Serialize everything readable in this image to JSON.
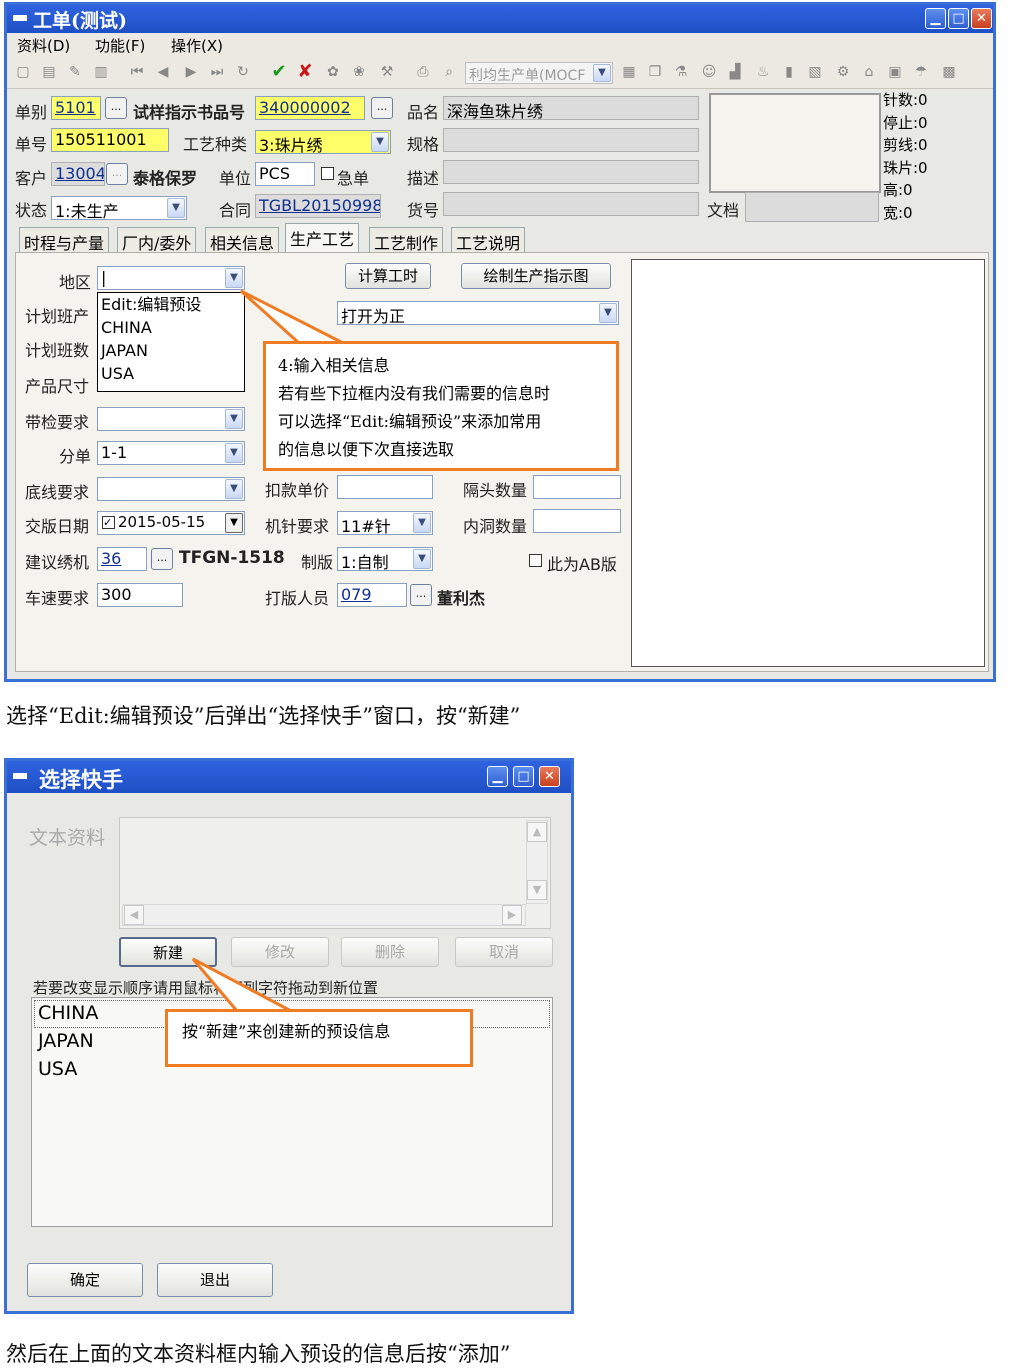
{
  "win1": {
    "title": "工单(测试)",
    "menu": [
      "资料(D)",
      "功能(F)",
      "操作(X)"
    ],
    "toolbar_combo": "利均生产单(MOCF",
    "header": {
      "danbie_label": "单别",
      "danbie_value": "5101",
      "zhishishu_label": "试样指示书品号",
      "zhishishu_value": "340000002",
      "pinming_label": "品名",
      "pinming_value": "深海鱼珠片绣",
      "danhao_label": "单号",
      "danhao_value": "150511001",
      "gongyi_label": "工艺种类",
      "gongyi_value": "3:珠片绣",
      "guige_label": "规格",
      "kehu_label": "客户",
      "kehu_value": "13004",
      "kehu_name": "泰格保罗",
      "danwei_label": "单位",
      "danwei_value": "PCS",
      "jidan_label": "急单",
      "miaoshu_label": "描述",
      "zhuangtai_label": "状态",
      "zhuangtai_value": "1:未生产",
      "hetong_label": "合同",
      "hetong_value": "TGBL20150998",
      "huohao_label": "货号",
      "wendang_label": "文档"
    },
    "stats": [
      "针数:0",
      "停止:0",
      "剪线:0",
      "珠片:0",
      "高:0",
      "宽:0"
    ],
    "tabs": [
      "时程与产量",
      "厂内/委外",
      "相关信息",
      "生产工艺",
      "工艺制作",
      "工艺说明"
    ],
    "form": {
      "diqu_label": "地区",
      "jisuan_button": "计算工时",
      "huizhi_button": "绘制生产指示图",
      "dropdown_options": [
        "Edit:编辑预设",
        "CHINA",
        "JAPAN",
        "USA"
      ],
      "jihuabanchan_label": "计划班产",
      "jihuabanshu_label": "计划班数",
      "chanpinchicun_label": "产品尺寸",
      "zhengfan_value": "打开为正",
      "daijian_label": "带检要求",
      "fendan_label": "分单",
      "fendan_value": "1-1",
      "dixian_label": "底线要求",
      "koukuan_label": "扣款单价",
      "getou_label": "隔头数量",
      "jiaoban_label": "交版日期",
      "jiaoban_value": "2015-05-15",
      "jizhen_label": "机针要求",
      "jizhen_value": "11#针",
      "neidong_label": "内洞数量",
      "xiuji_label": "建议绣机",
      "xiuji_value": "36",
      "xiuji_model": "TFGN-1518",
      "zhiban_label": "制版",
      "zhiban_value": "1:自制",
      "ab_label": "此为AB版",
      "chesu_label": "车速要求",
      "chesu_value": "300",
      "daban_label": "打版人员",
      "daban_value": "079",
      "daban_name": "董利杰"
    },
    "callout": [
      "4:输入相关信息",
      "若有些下拉框内没有我们需要的信息时",
      "可以选择“Edit:编辑预设”来添加常用",
      "的信息以便下次直接选取"
    ]
  },
  "caption1": "选择“Edit:编辑预设”后弹出“选择快手”窗口，按“新建”",
  "win2": {
    "title": "选择快手",
    "text_label": "文本资料",
    "buttons": [
      "新建",
      "修改",
      "删除",
      "取消"
    ],
    "hint": "若要改变显示顺序请用鼠标将下列字符拖动到新位置",
    "items": [
      "CHINA",
      "JAPAN",
      "USA"
    ],
    "callout": "按“新建”来创建新的预设信息",
    "ok_button": "确定",
    "exit_button": "退出"
  },
  "caption2": "然后在上面的文本资料框内输入预设的信息后按“添加”",
  "colors": {
    "title_blue": "#2f63e0",
    "callout_orange": "#ef7b22",
    "required_yellow": "#ffff6a"
  }
}
